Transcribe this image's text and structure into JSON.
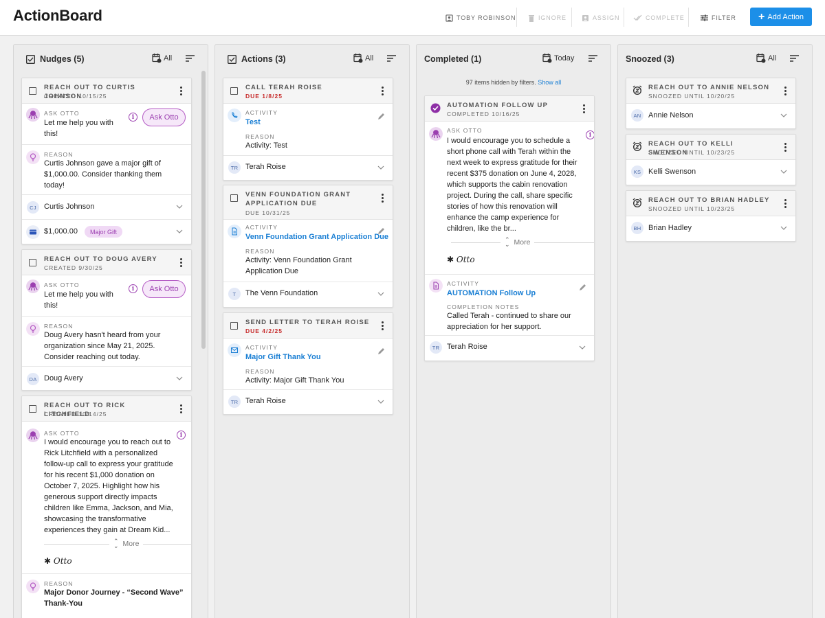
{
  "app": {
    "title": "ActionBoard"
  },
  "toolbar": {
    "user": "TOBY ROBINSON",
    "ignore": "IGNORE",
    "assign": "ASSIGN",
    "complete": "COMPLETE",
    "filter": "FILTER",
    "add_action": "Add Action"
  },
  "columns": {
    "nudges": {
      "title": "Nudges (5)",
      "filter": "All"
    },
    "actions": {
      "title": "Actions (3)",
      "filter": "All"
    },
    "completed": {
      "title": "Completed (1)",
      "filter": "Today",
      "hidden_text": "97 items hidden by filters.",
      "show_all": "Show all"
    },
    "snoozed": {
      "title": "Snoozed (3)",
      "filter": "All"
    }
  },
  "labels": {
    "ask_otto": "ASK OTTO",
    "reason": "REASON",
    "activity": "ACTIVITY",
    "completion_notes": "COMPLETION NOTES",
    "more": "More",
    "ask_otto_btn": "Ask Otto",
    "otto_sig": "Otto"
  },
  "nudges": [
    {
      "title": "REACH OUT TO CURTIS JOHNSON",
      "sub": "CREATED 10/15/25",
      "otto_l1": "Let me help you with",
      "otto_l2": "this!",
      "reason_l1": "Curtis Johnson gave a major gift of",
      "reason_l2": "$1,000.00. Consider thanking them",
      "reason_l3": "today!",
      "person_initials": "CJ",
      "person": "Curtis Johnson",
      "amount": "$1,000.00",
      "tag": "Major Gift"
    },
    {
      "title": "REACH OUT TO DOUG AVERY",
      "sub": "CREATED 9/30/25",
      "otto_l1": "Let me help you with",
      "otto_l2": "this!",
      "reason_l1": "Doug Avery hasn't heard from your",
      "reason_l2": "organization since May 21, 2025.",
      "reason_l3": "Consider reaching out today.",
      "person_initials": "DA",
      "person": "Doug Avery"
    },
    {
      "title": "REACH OUT TO RICK LITCHFIELD",
      "sub": "CREATED 10/14/25",
      "otto_lines": [
        "I would encourage you to reach out to",
        "Rick Litchfield with a personalized",
        "follow-up call to express your gratitude",
        "for his recent $1,000 donation on",
        "October 7, 2025. Highlight how his",
        "generous support directly impacts",
        "children like Emma, Jackson, and Mia,",
        "showcasing the transformative",
        "experiences they gain at Dream Kid..."
      ],
      "reason_l1": "Major Donor Journey - “Second Wave”",
      "reason_l2": "Thank-You"
    }
  ],
  "actions": [
    {
      "title": "CALL TERAH ROISE",
      "due": "DUE 1/8/25",
      "activity": "Test",
      "reason": "Activity: Test",
      "person_initials": "TR",
      "person": "Terah Roise"
    },
    {
      "title_l1": "VENN FOUNDATION GRANT",
      "title_l2": "APPLICATION DUE",
      "due": "DUE 10/31/25",
      "activity": "Venn Foundation Grant Application Due",
      "reason_l1": "Activity: Venn Foundation Grant",
      "reason_l2": "Application Due",
      "person_initials": "T",
      "person": "The Venn Foundation"
    },
    {
      "title": "SEND LETTER TO TERAH ROISE",
      "due": "DUE 4/2/25",
      "activity": "Major Gift Thank You",
      "reason": "Activity: Major Gift Thank You",
      "person_initials": "TR",
      "person": "Terah Roise"
    }
  ],
  "completed": [
    {
      "title": "AUTOMATION FOLLOW UP",
      "sub": "COMPLETED 10/16/25",
      "otto_lines": [
        "I would encourage you to schedule a",
        "short phone call with Terah within the",
        "next week to express gratitude for their",
        "recent $375 donation on June 4, 2028,",
        "which supports the cabin renovation",
        "project. During the call, share specific",
        "stories of how this renovation will",
        "enhance the camp experience for",
        "children, like the br..."
      ],
      "activity": "AUTOMATION Follow Up",
      "notes_l1": "Called Terah - continued to share our",
      "notes_l2": "appreciation for her support.",
      "person_initials": "TR",
      "person": "Terah Roise"
    }
  ],
  "snoozed": [
    {
      "title": "REACH OUT TO ANNIE NELSON",
      "sub": "SNOOZED UNTIL 10/20/25",
      "person_initials": "AN",
      "person": "Annie Nelson"
    },
    {
      "title": "REACH OUT TO KELLI SWENSON",
      "sub": "SNOOZED UNTIL 10/23/25",
      "person_initials": "KS",
      "person": "Kelli Swenson"
    },
    {
      "title": "REACH OUT TO BRIAN HADLEY",
      "sub": "SNOOZED UNTIL 10/23/25",
      "person_initials": "BH",
      "person": "Brian Hadley"
    }
  ],
  "colors": {
    "accent": "#1c8fe8",
    "otto_purple": "#9b3fb0",
    "due_red": "#c62828"
  }
}
